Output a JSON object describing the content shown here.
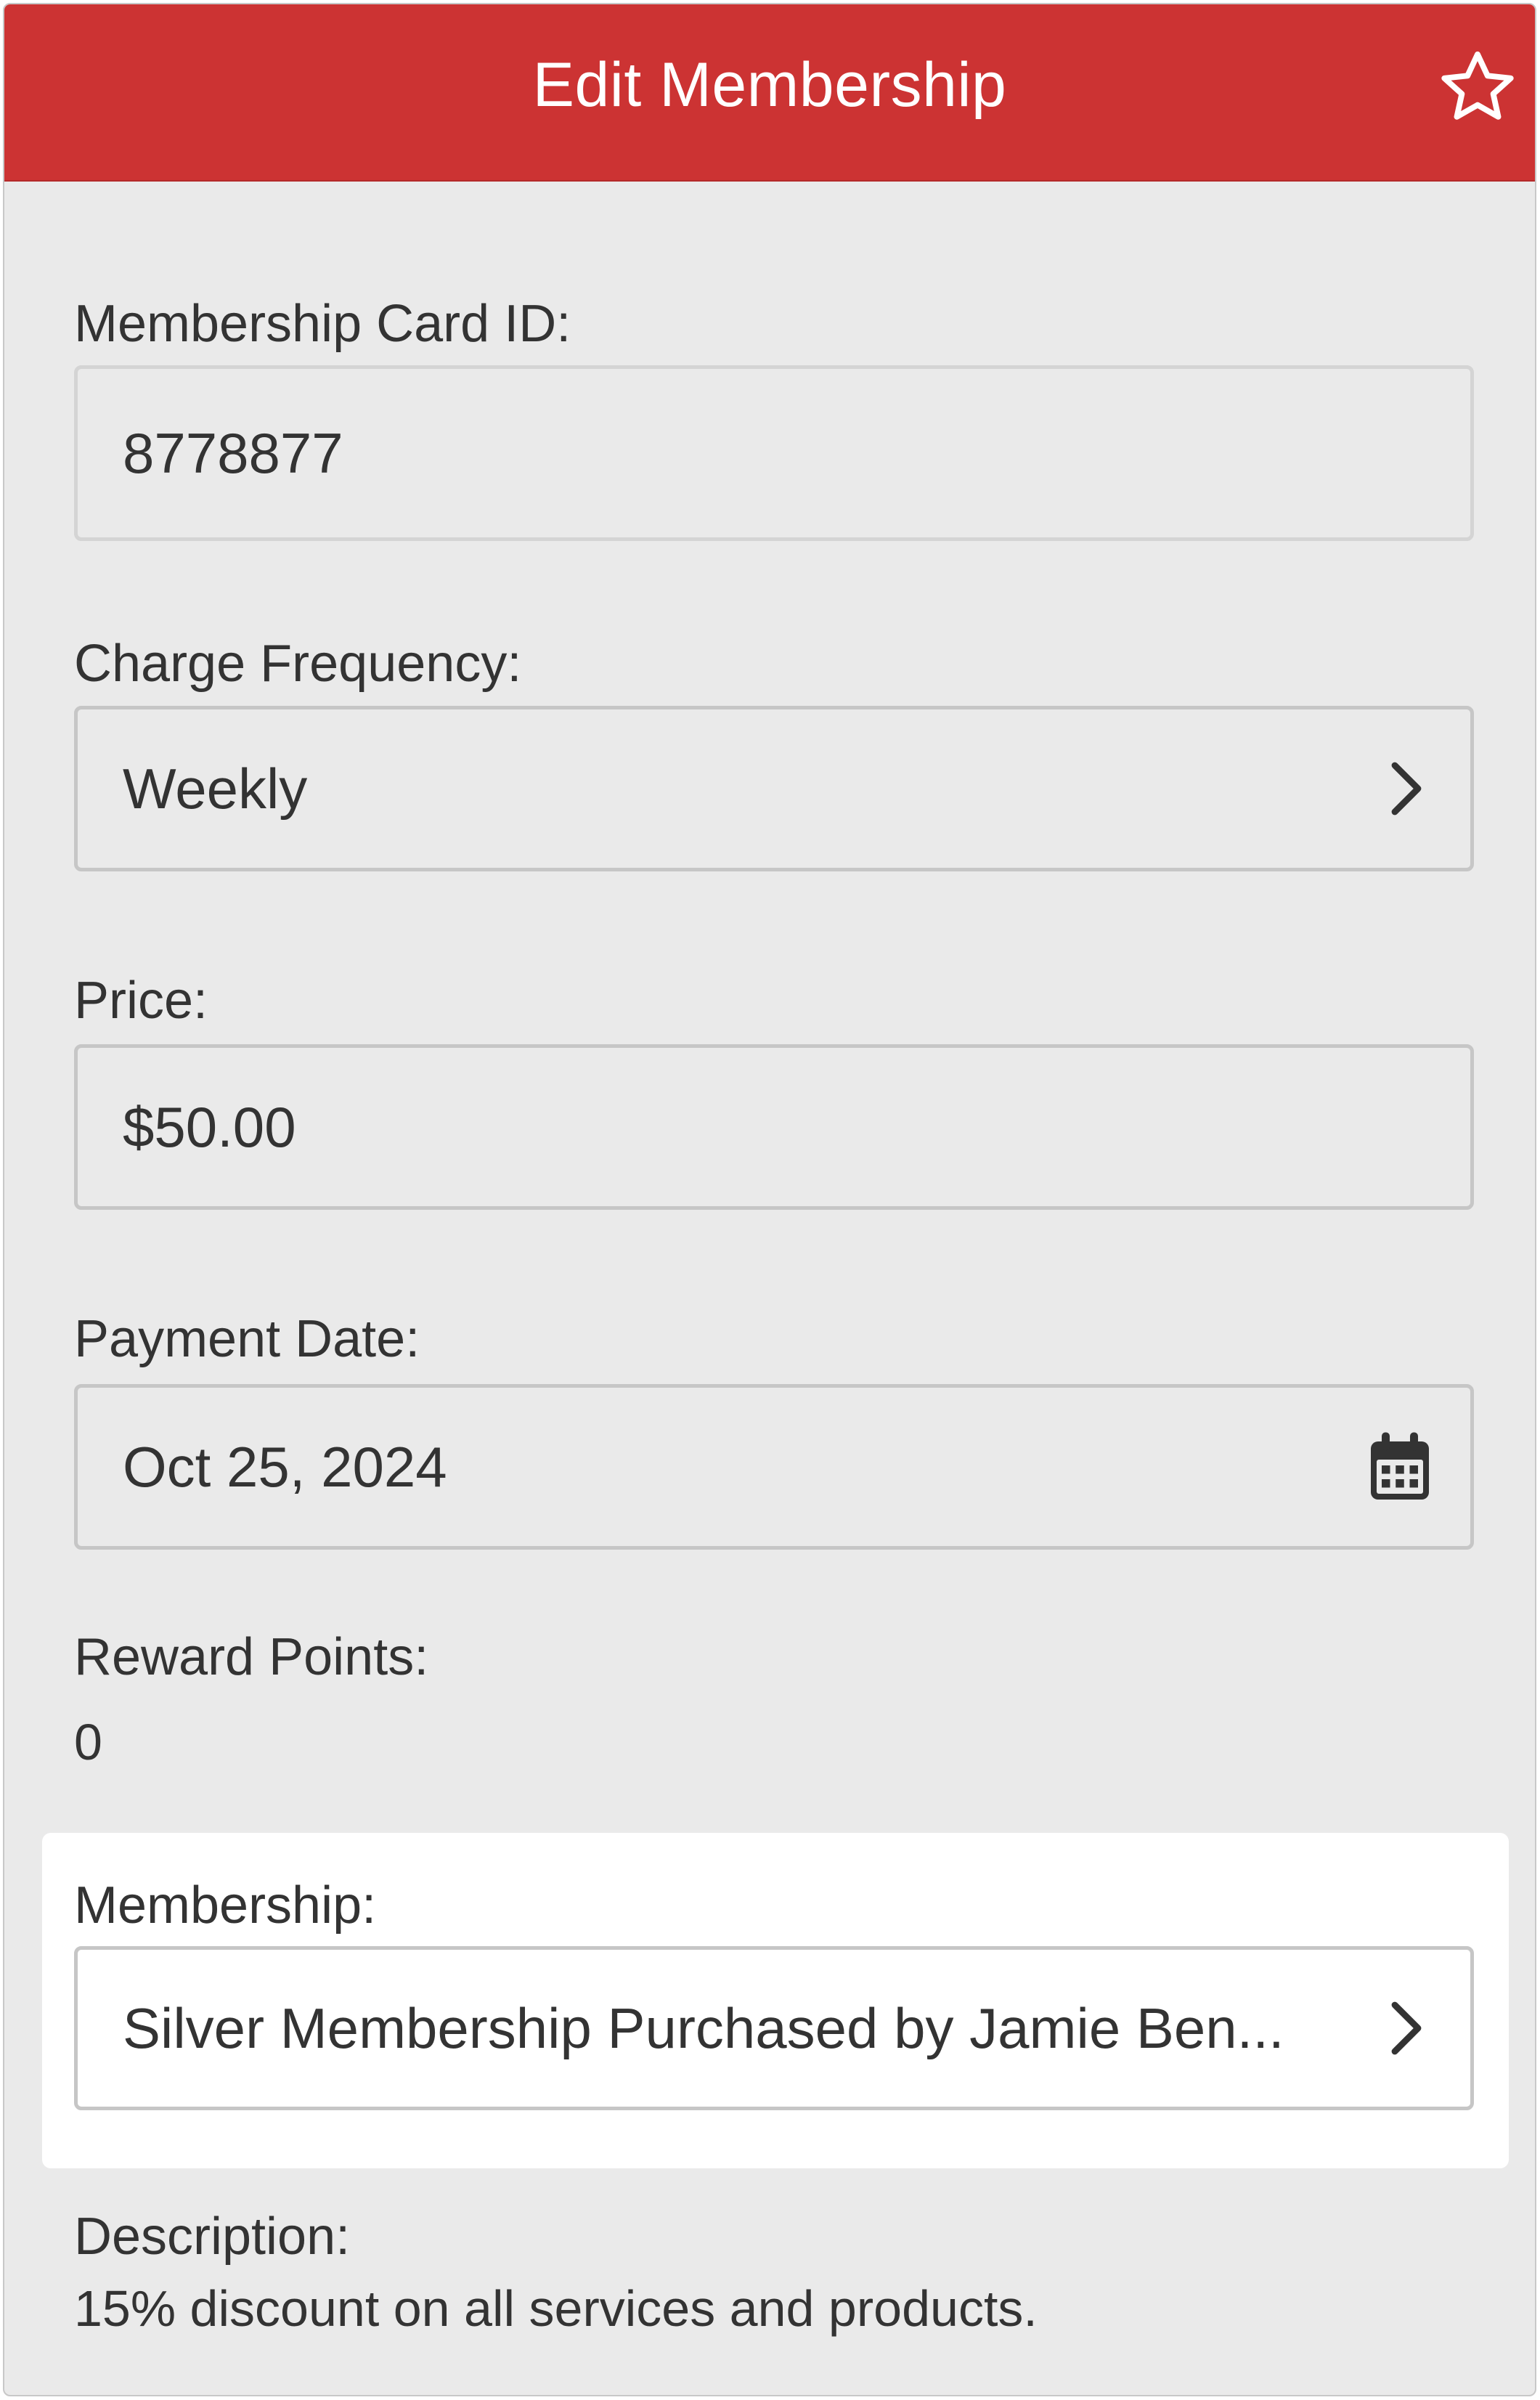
{
  "header": {
    "title": "Edit Membership",
    "favorite_icon": "star-outline-icon",
    "color": "#cc3333"
  },
  "form": {
    "card_id": {
      "label": "Membership Card ID:",
      "value": "8778877"
    },
    "charge_frequency": {
      "label": "Charge Frequency:",
      "value": "Weekly",
      "icon": "chevron-right-icon"
    },
    "price": {
      "label": "Price:",
      "value": "$50.00"
    },
    "payment_date": {
      "label": "Payment Date:",
      "value": "Oct 25, 2024",
      "icon": "calendar-icon"
    },
    "reward_points": {
      "label": "Reward Points:",
      "value": "0"
    },
    "membership": {
      "label": "Membership:",
      "value": "Silver Membership Purchased by Jamie Ben...",
      "icon": "chevron-right-icon"
    },
    "description": {
      "label": "Description:",
      "value": "15% discount on all services and products."
    }
  }
}
